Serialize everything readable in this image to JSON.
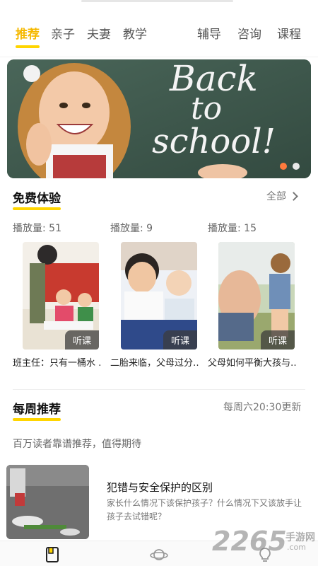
{
  "nav": {
    "left_tabs": [
      "推荐",
      "亲子",
      "夫妻",
      "教学"
    ],
    "right_tabs": [
      "辅导",
      "咨询",
      "课程"
    ],
    "active_index": 0
  },
  "banner": {
    "chalk_text": [
      "Back",
      "to",
      "school!"
    ],
    "dot_count": 2,
    "active_dot": 0
  },
  "free_trial": {
    "title": "免费体验",
    "more_label": "全部",
    "cards": [
      {
        "plays": "播放量: 51",
        "badge": "听课",
        "title": "班主任：只有一桶水 …"
      },
      {
        "plays": "播放量: 9",
        "badge": "听课",
        "title": "二胎来临，父母过分…"
      },
      {
        "plays": "播放量: 15",
        "badge": "听课",
        "title": "父母如何平衡大孩与…"
      }
    ]
  },
  "weekly": {
    "title": "每周推荐",
    "update_note": "每周六20:30更新",
    "subtitle": "百万读者靠谱推荐，值得期待",
    "item": {
      "title": "犯错与安全保护的区别",
      "desc": "家长什么情况下该保护孩子？什么情况下又该放手让孩子去试错呢？"
    }
  },
  "tabbar": {
    "icons": [
      "book-icon",
      "planet-icon",
      "bulb-icon"
    ]
  },
  "watermark": {
    "number": "2265",
    "sub_cn": "手游网",
    "sub_url": ".com"
  },
  "colors": {
    "accent": "#ffd500",
    "active_text": "#f5b800",
    "dot_active": "#ff7a3d"
  }
}
